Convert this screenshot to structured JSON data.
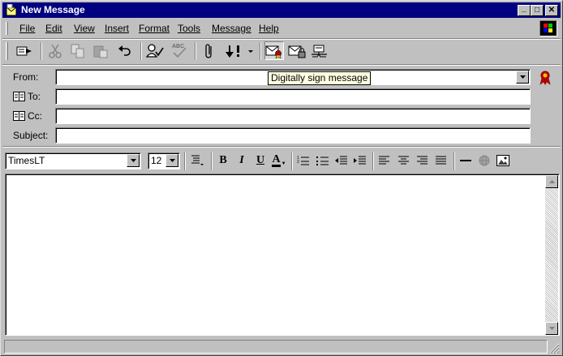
{
  "window": {
    "title": "New Message",
    "controls": {
      "minimize": "_",
      "maximize": "□",
      "close": "✕"
    }
  },
  "menu": {
    "items": [
      {
        "label": "File"
      },
      {
        "label": "Edit"
      },
      {
        "label": "View"
      },
      {
        "label": "Insert"
      },
      {
        "label": "Format"
      },
      {
        "label": "Tools"
      },
      {
        "label": "Message"
      },
      {
        "label": "Help"
      }
    ]
  },
  "toolbar": {
    "buttons": [
      {
        "icon": "send-icon"
      },
      {
        "icon": "cut-icon",
        "enabled": false
      },
      {
        "icon": "copy-icon",
        "enabled": false
      },
      {
        "icon": "paste-icon",
        "enabled": false
      },
      {
        "icon": "undo-icon"
      },
      {
        "icon": "check-names-icon"
      },
      {
        "icon": "spelling-icon",
        "label": "ABC",
        "enabled": false
      },
      {
        "icon": "attach-icon"
      },
      {
        "icon": "priority-icon"
      },
      {
        "icon": "sign-icon",
        "pressed": true
      },
      {
        "icon": "encrypt-icon"
      },
      {
        "icon": "offline-icon"
      }
    ]
  },
  "header": {
    "from": {
      "label": "From:",
      "value": ""
    },
    "to": {
      "label": "To:",
      "value": ""
    },
    "cc": {
      "label": "Cc:",
      "value": ""
    },
    "subject": {
      "label": "Subject:",
      "value": ""
    },
    "tooltip": "Digitally sign message"
  },
  "format": {
    "font_name": "TimesLT",
    "font_size": "12",
    "bold": "B",
    "italic": "I",
    "underline": "U",
    "font_color": "A"
  },
  "body": {
    "text": ""
  },
  "status": {
    "text": ""
  },
  "colors": {
    "title_bar": "#000080",
    "face": "#c0c0c0",
    "tooltip": "#ffffe1"
  }
}
